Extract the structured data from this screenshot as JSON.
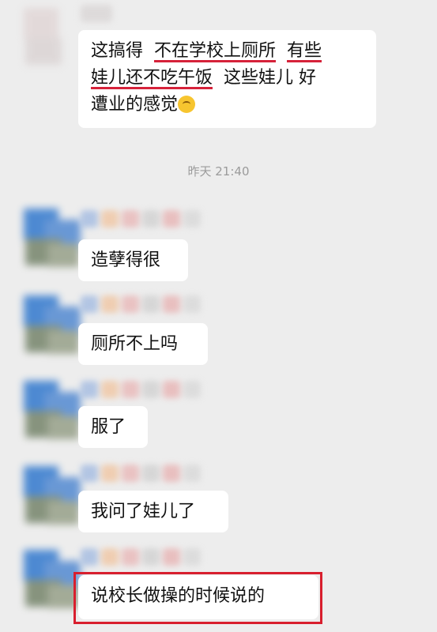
{
  "messages": [
    {
      "segments": [
        {
          "text": "这搞得  ",
          "underline": false
        },
        {
          "text": "不在学校上厕所",
          "underline": true
        },
        {
          "text": "  ",
          "underline": false
        },
        {
          "text": "有些",
          "underline": true
        }
      ],
      "line2": [
        {
          "text": "娃儿还不吃午饭",
          "underline": true
        },
        {
          "text": "  这些娃儿 好",
          "underline": false
        }
      ],
      "line3": "遭业的感觉",
      "emoji": "thinking-face-icon"
    }
  ],
  "timestamp": "昨天 21:40",
  "incoming": [
    {
      "text": "造孽得很"
    },
    {
      "text": "厕所不上吗"
    },
    {
      "text": "服了"
    },
    {
      "text": "我问了娃儿了"
    },
    {
      "text": "说校长做操的时候说的"
    }
  ],
  "colors": {
    "underline": "#d6223a",
    "highlight_box": "#d81f2e",
    "background": "#ededed"
  }
}
